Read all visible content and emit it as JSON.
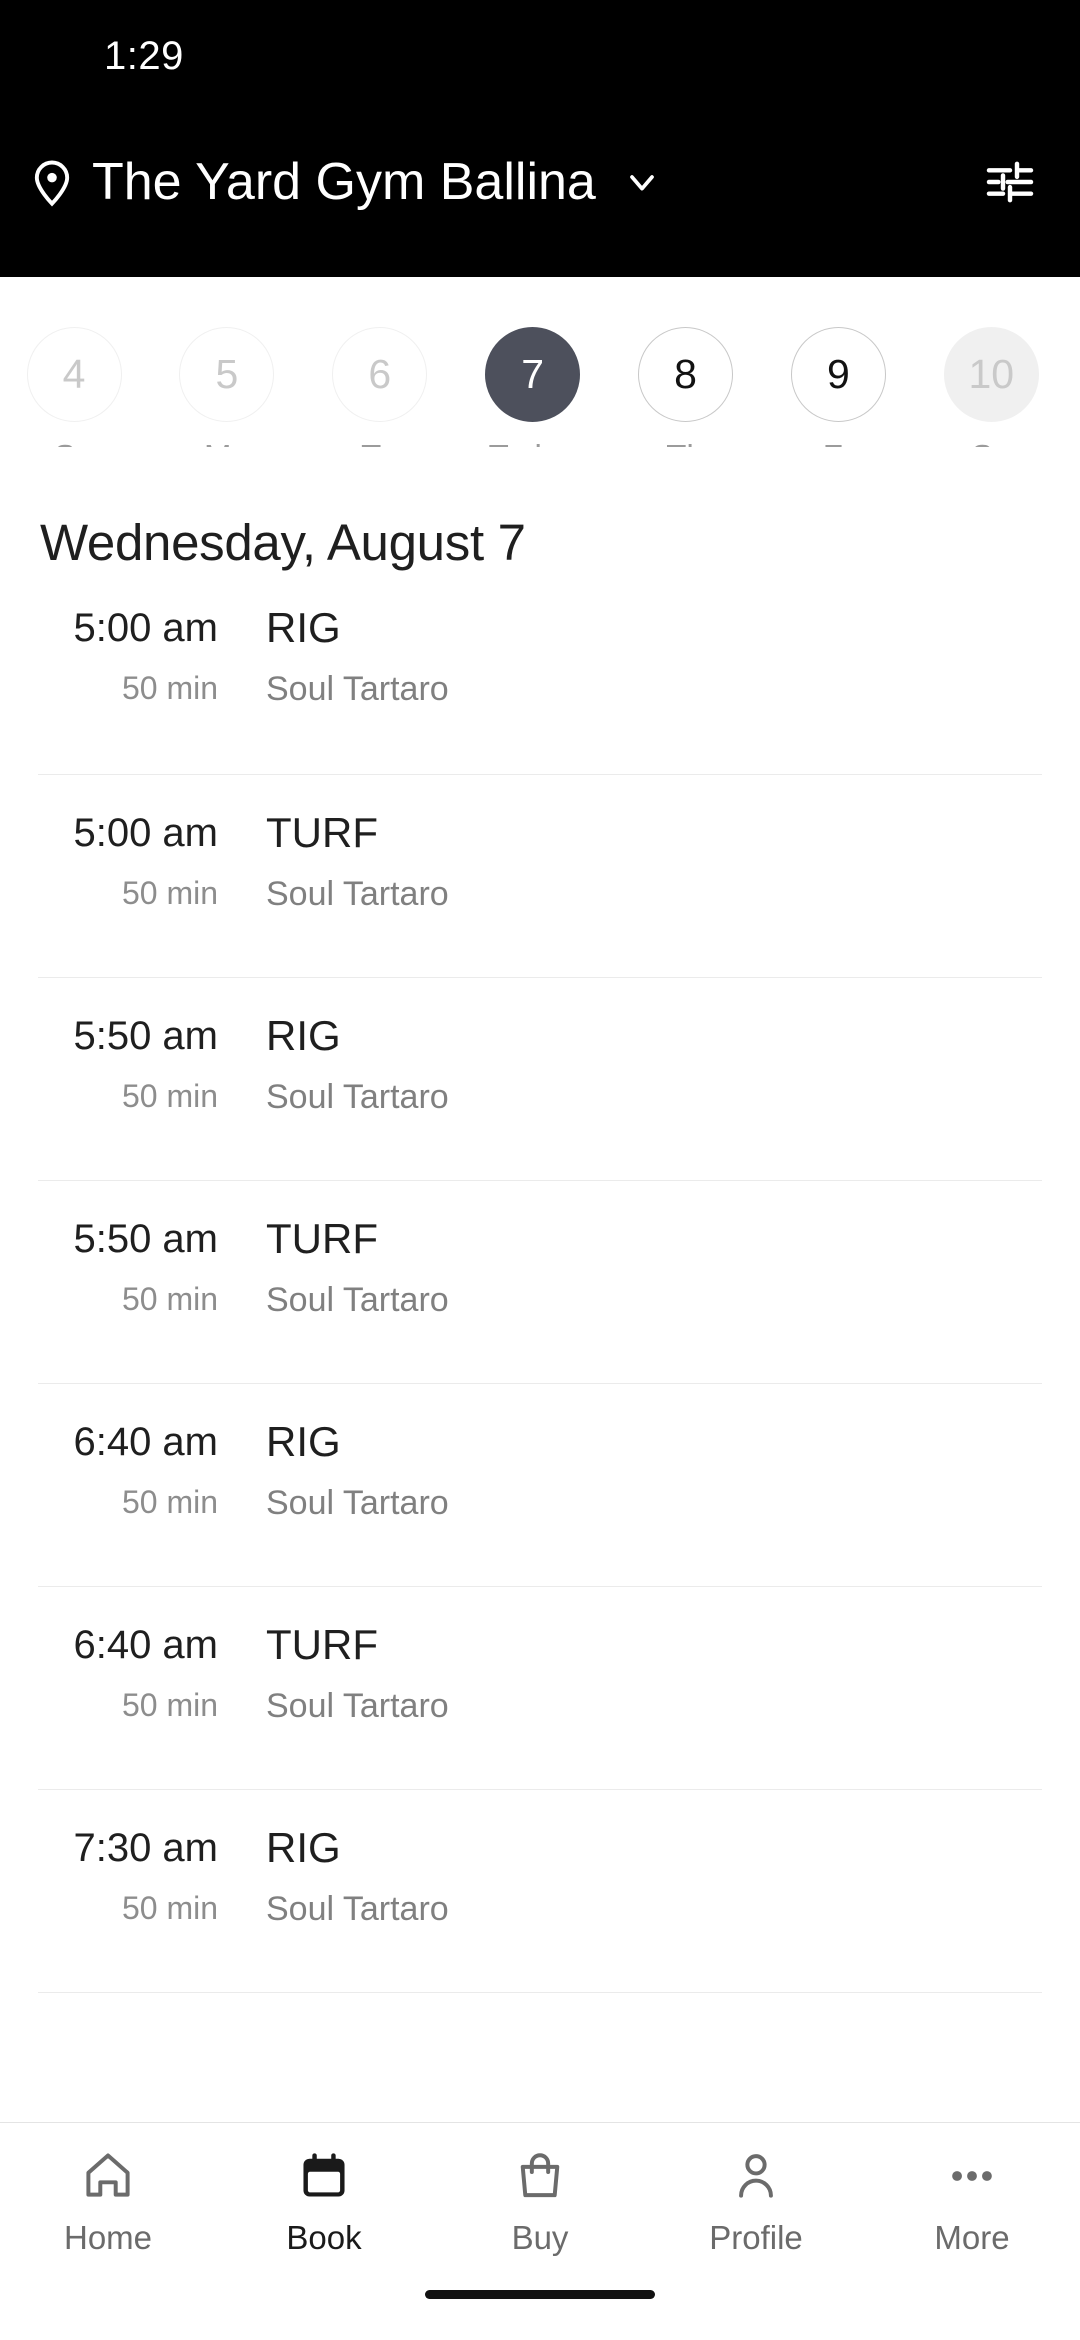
{
  "status_bar": {
    "time": "1:29"
  },
  "app_bar": {
    "location_icon": "map-pin-icon",
    "venue": "The Yard Gym Ballina",
    "chevron_icon": "chevron-down-icon",
    "filter_icon": "filter-sliders-icon"
  },
  "date_strip": {
    "days": [
      {
        "num": "4",
        "label": "Su",
        "state": "past"
      },
      {
        "num": "5",
        "label": "Mo",
        "state": "past"
      },
      {
        "num": "6",
        "label": "Tu",
        "state": "past"
      },
      {
        "num": "7",
        "label": "Today",
        "state": "selected"
      },
      {
        "num": "8",
        "label": "Th",
        "state": "normal"
      },
      {
        "num": "9",
        "label": "Fr",
        "state": "normal"
      },
      {
        "num": "10",
        "label": "Sa",
        "state": "future"
      }
    ]
  },
  "schedule": {
    "heading": "Wednesday, August 7",
    "classes": [
      {
        "time": "5:00 am",
        "duration": "50 min",
        "name": "RIG",
        "coach": "Soul Tartaro"
      },
      {
        "time": "5:00 am",
        "duration": "50 min",
        "name": "TURF",
        "coach": "Soul Tartaro"
      },
      {
        "time": "5:50 am",
        "duration": "50 min",
        "name": "RIG",
        "coach": "Soul Tartaro"
      },
      {
        "time": "5:50 am",
        "duration": "50 min",
        "name": "TURF",
        "coach": "Soul Tartaro"
      },
      {
        "time": "6:40 am",
        "duration": "50 min",
        "name": "RIG",
        "coach": "Soul Tartaro"
      },
      {
        "time": "6:40 am",
        "duration": "50 min",
        "name": "TURF",
        "coach": "Soul Tartaro"
      },
      {
        "time": "7:30 am",
        "duration": "50 min",
        "name": "RIG",
        "coach": "Soul Tartaro"
      }
    ]
  },
  "bottom_nav": {
    "items": [
      {
        "label": "Home",
        "icon": "home-icon",
        "active": false
      },
      {
        "label": "Book",
        "icon": "calendar-icon",
        "active": true
      },
      {
        "label": "Buy",
        "icon": "bag-icon",
        "active": false
      },
      {
        "label": "Profile",
        "icon": "person-icon",
        "active": false
      },
      {
        "label": "More",
        "icon": "ellipsis-icon",
        "active": false
      }
    ]
  },
  "colors": {
    "app_bar_bg": "#000000",
    "selected_pill": "#4d505c",
    "future_pill": "#f0f0f0",
    "muted_text": "#9b9b9b",
    "primary_text": "#1f1f1f",
    "divider": "#ebebeb"
  }
}
